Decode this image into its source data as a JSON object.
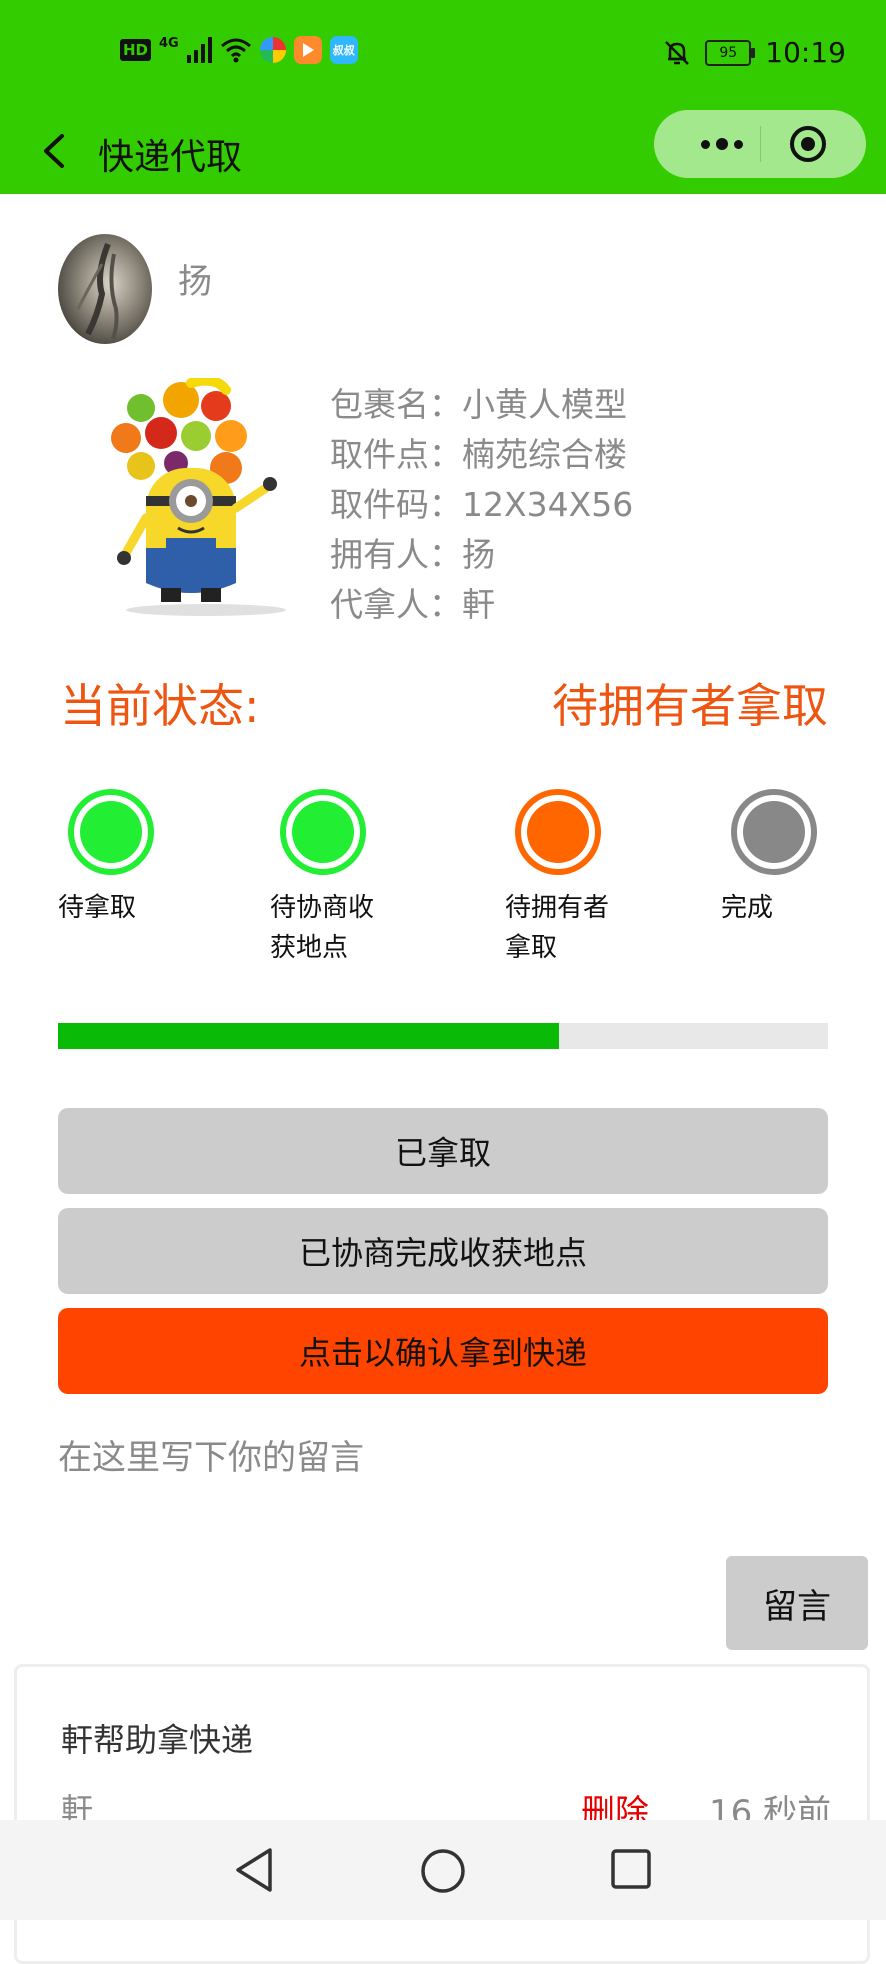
{
  "status_bar": {
    "left_badges": [
      "HD",
      "4G"
    ],
    "app_icon_text": "叔叔",
    "battery": "95",
    "time": "10:19"
  },
  "navbar": {
    "title": "快递代取"
  },
  "user": {
    "name": "扬"
  },
  "package": {
    "rows": [
      {
        "label": "包裹名：",
        "value": "小黄人模型"
      },
      {
        "label": "取件点：",
        "value": "楠苑综合楼"
      },
      {
        "label": "取件码：",
        "value": "12X34X56"
      },
      {
        "label": "拥有人：",
        "value": "扬"
      },
      {
        "label": "代拿人：",
        "value": "軒"
      }
    ]
  },
  "current_status": {
    "label": "当前状态:",
    "value": "待拥有者拿取"
  },
  "steps": [
    {
      "line1": "待拿取",
      "line2": "",
      "color": "#22ee33",
      "state": "done"
    },
    {
      "line1": "待协商收",
      "line2": "获地点",
      "color": "#22ee33",
      "state": "done"
    },
    {
      "line1": "待拥有者",
      "line2": "拿取",
      "color": "#ff6600",
      "state": "current"
    },
    {
      "line1": "完成",
      "line2": "",
      "color": "#888888",
      "state": "pending"
    }
  ],
  "progress": {
    "fraction": 0.65,
    "fill_color": "#09bb07"
  },
  "buttons": {
    "picked_up": "已拿取",
    "location_agreed": "已协商完成收获地点",
    "confirm_received": "点击以确认拿到快递"
  },
  "message": {
    "placeholder": "在这里写下你的留言",
    "send_label": "留言"
  },
  "comments": [
    {
      "title": "軒帮助拿快递",
      "user": "軒",
      "delete_label": "删除",
      "time": "16 秒前"
    }
  ],
  "colors": {
    "brand_green": "#33cc00",
    "accent_orange": "#ee5511",
    "button_orange": "#ff4400",
    "delete_red": "#e60000"
  }
}
